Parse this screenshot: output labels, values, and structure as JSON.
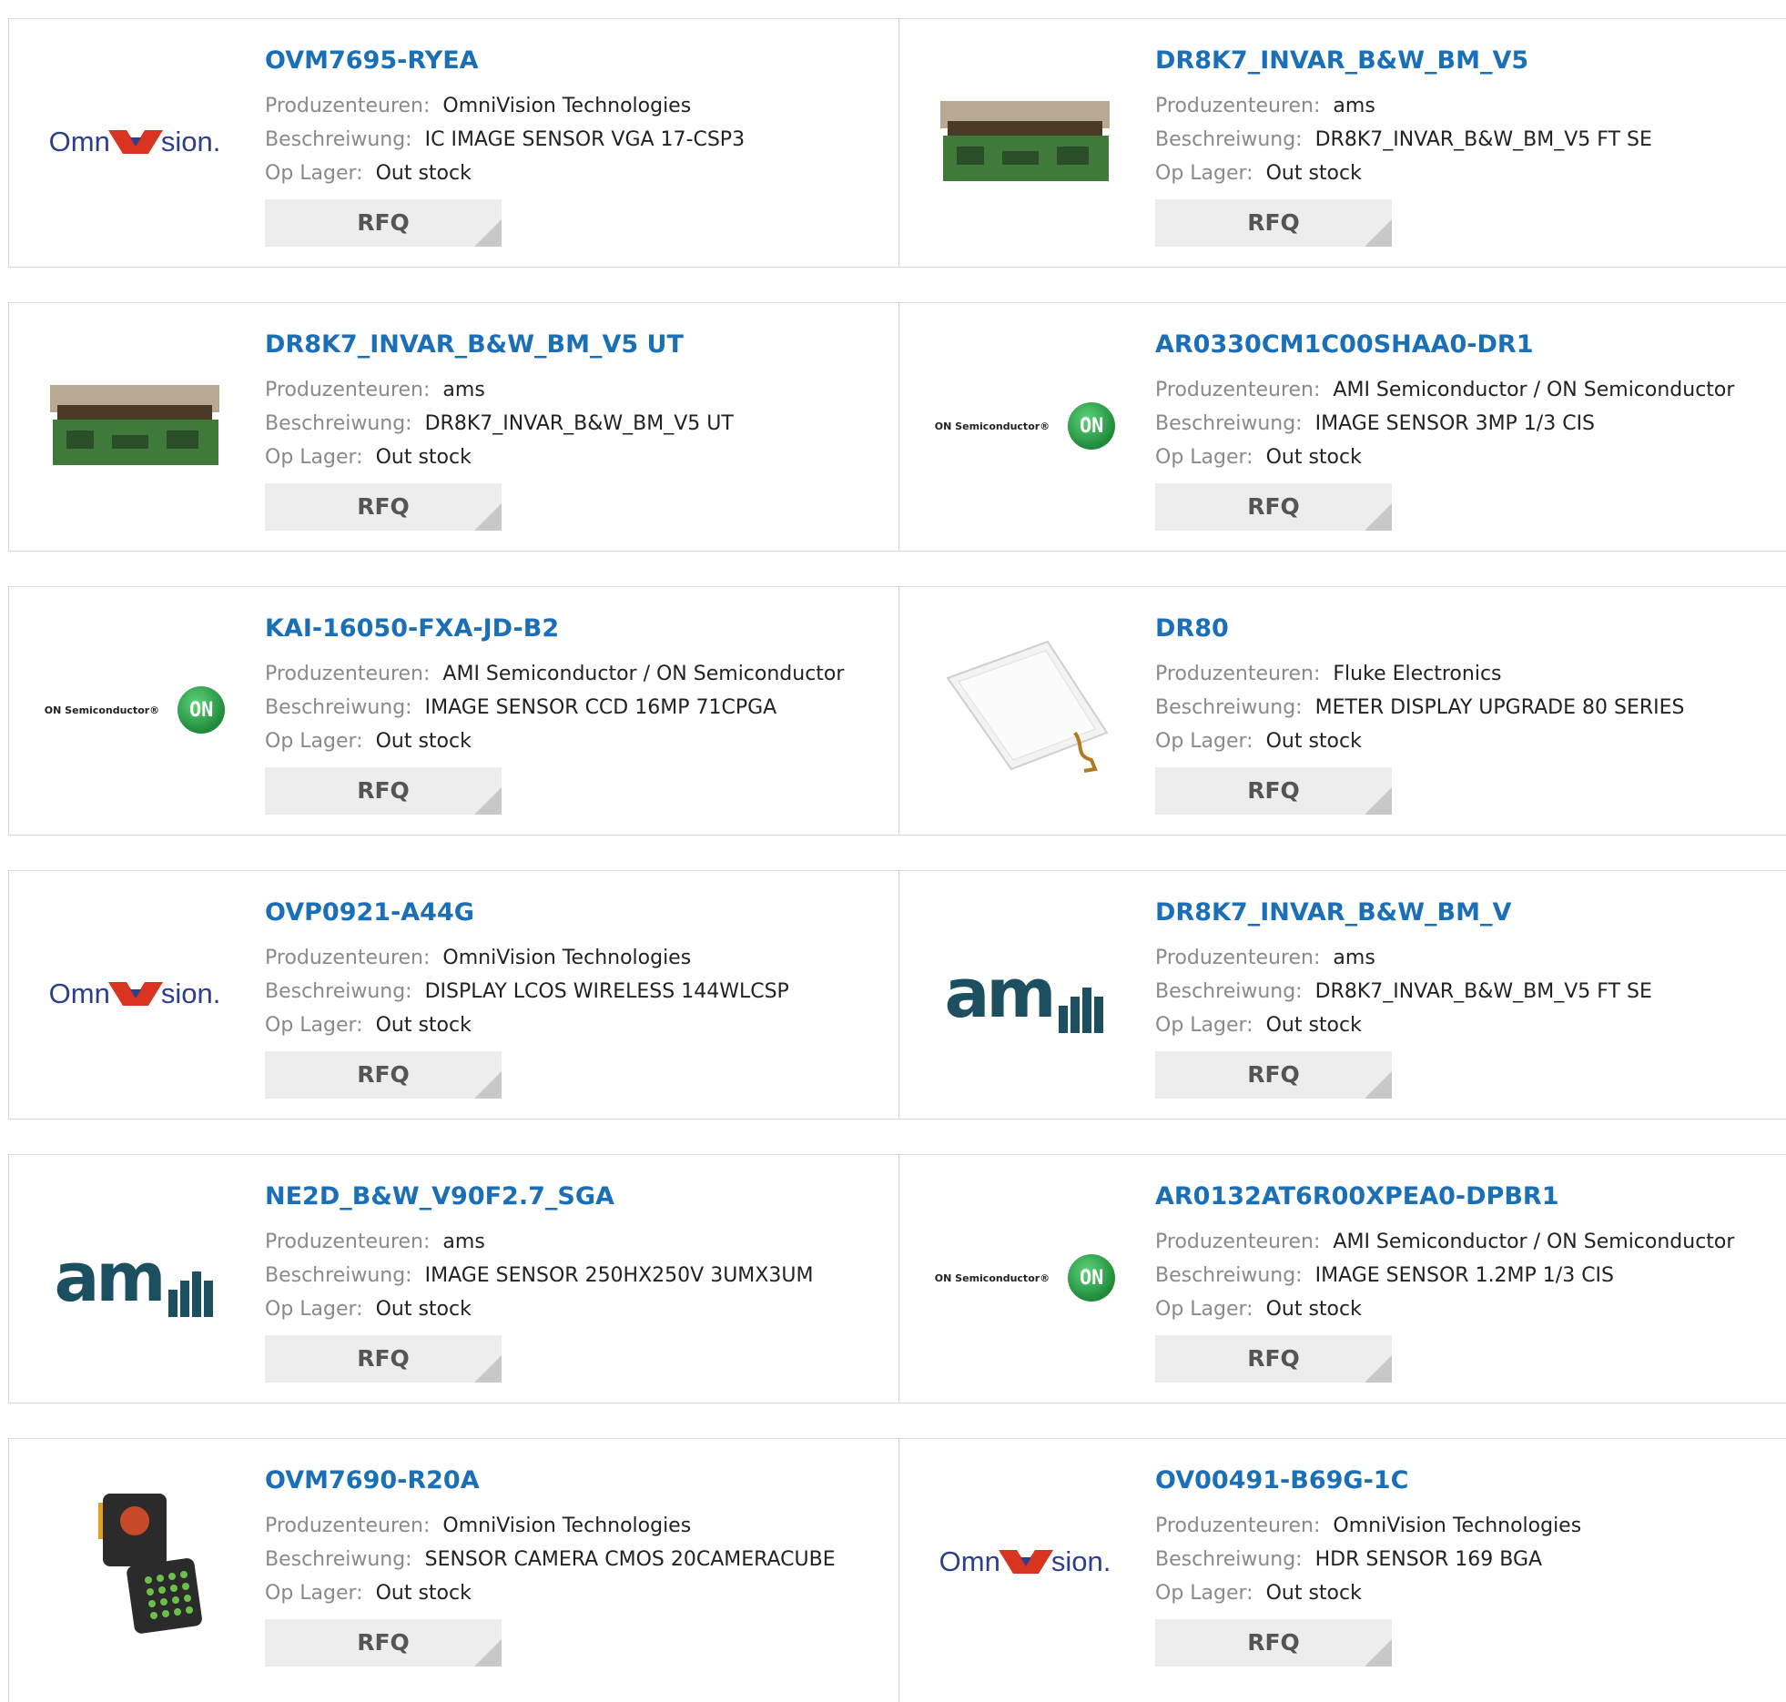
{
  "labels": {
    "manufacturer": "Produzenteuren:",
    "description": "Beschreiwung:",
    "stock": "Op Lager:",
    "rfq": "RFQ"
  },
  "colors": {
    "link": "#1a6fb6",
    "label": "#8a8a8a",
    "button_bg": "#ededed"
  },
  "products": [
    {
      "part": "OVM7695-RYEA",
      "manufacturer": "OmniVision Technologies",
      "description": "IC IMAGE SENSOR VGA 17-CSP3",
      "stock": "Out stock",
      "logo": "omnivision-logo"
    },
    {
      "part": "DR8K7_INVAR_B&W_BM_V5",
      "manufacturer": "ams",
      "description": "DR8K7_INVAR_B&W_BM_V5 FT SE",
      "stock": "Out stock",
      "logo": "sensor-board-image"
    },
    {
      "part": "DR8K7_INVAR_B&W_BM_V5 UT",
      "manufacturer": "ams",
      "description": "DR8K7_INVAR_B&W_BM_V5 UT",
      "stock": "Out stock",
      "logo": "sensor-board-image"
    },
    {
      "part": "AR0330CM1C00SHAA0-DR1",
      "manufacturer": "AMI Semiconductor / ON Semiconductor",
      "description": "IMAGE SENSOR 3MP 1/3 CIS",
      "stock": "Out stock",
      "logo": "on-semiconductor-logo",
      "logo_text": "ON Semiconductor®",
      "logo_mark": "ON"
    },
    {
      "part": "KAI-16050-FXA-JD-B2",
      "manufacturer": "AMI Semiconductor / ON Semiconductor",
      "description": "IMAGE SENSOR CCD 16MP 71CPGA",
      "stock": "Out stock",
      "logo": "on-semiconductor-logo",
      "logo_text": "ON Semiconductor®",
      "logo_mark": "ON"
    },
    {
      "part": "DR80",
      "manufacturer": "Fluke Electronics",
      "description": "METER DISPLAY UPGRADE 80 SERIES",
      "stock": "Out stock",
      "logo": "display-panel-image"
    },
    {
      "part": "OVP0921-A44G",
      "manufacturer": "OmniVision Technologies",
      "description": "DISPLAY LCOS WIRELESS 144WLCSP",
      "stock": "Out stock",
      "logo": "omnivision-logo"
    },
    {
      "part": "DR8K7_INVAR_B&W_BM_V",
      "manufacturer": "ams",
      "description": "DR8K7_INVAR_B&W_BM_V5 FT SE",
      "stock": "Out stock",
      "logo": "ams-logo"
    },
    {
      "part": "NE2D_B&W_V90F2.7_SGA",
      "manufacturer": "ams",
      "description": "IMAGE SENSOR 250HX250V 3UMX3UM",
      "stock": "Out stock",
      "logo": "ams-logo"
    },
    {
      "part": "AR0132AT6R00XPEA0-DPBR1",
      "manufacturer": "AMI Semiconductor / ON Semiconductor",
      "description": "IMAGE SENSOR 1.2MP 1/3 CIS",
      "stock": "Out stock",
      "logo": "on-semiconductor-logo",
      "logo_text": "ON Semiconductor®",
      "logo_mark": "ON"
    },
    {
      "part": "OVM7690-R20A",
      "manufacturer": "OmniVision Technologies",
      "description": "SENSOR CAMERA CMOS 20CAMERACUBE",
      "stock": "Out stock",
      "logo": "camera-cube-image"
    },
    {
      "part": "OV00491-B69G-1C",
      "manufacturer": "OmniVision Technologies",
      "description": "HDR SENSOR 169 BGA",
      "stock": "Out stock",
      "logo": "omnivision-logo"
    }
  ]
}
